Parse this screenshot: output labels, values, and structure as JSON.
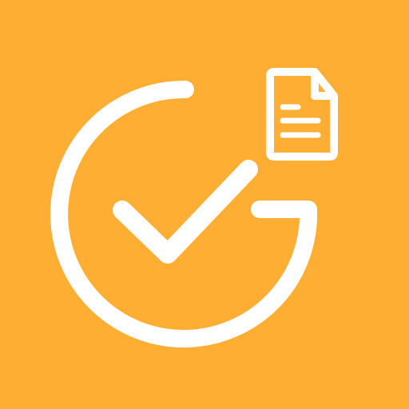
{
  "app_icon": {
    "background_color": "#FFAE34",
    "foreground_color": "#FFFFFF",
    "icons": [
      "open-ring-icon",
      "checkmark-icon",
      "document-icon"
    ]
  }
}
